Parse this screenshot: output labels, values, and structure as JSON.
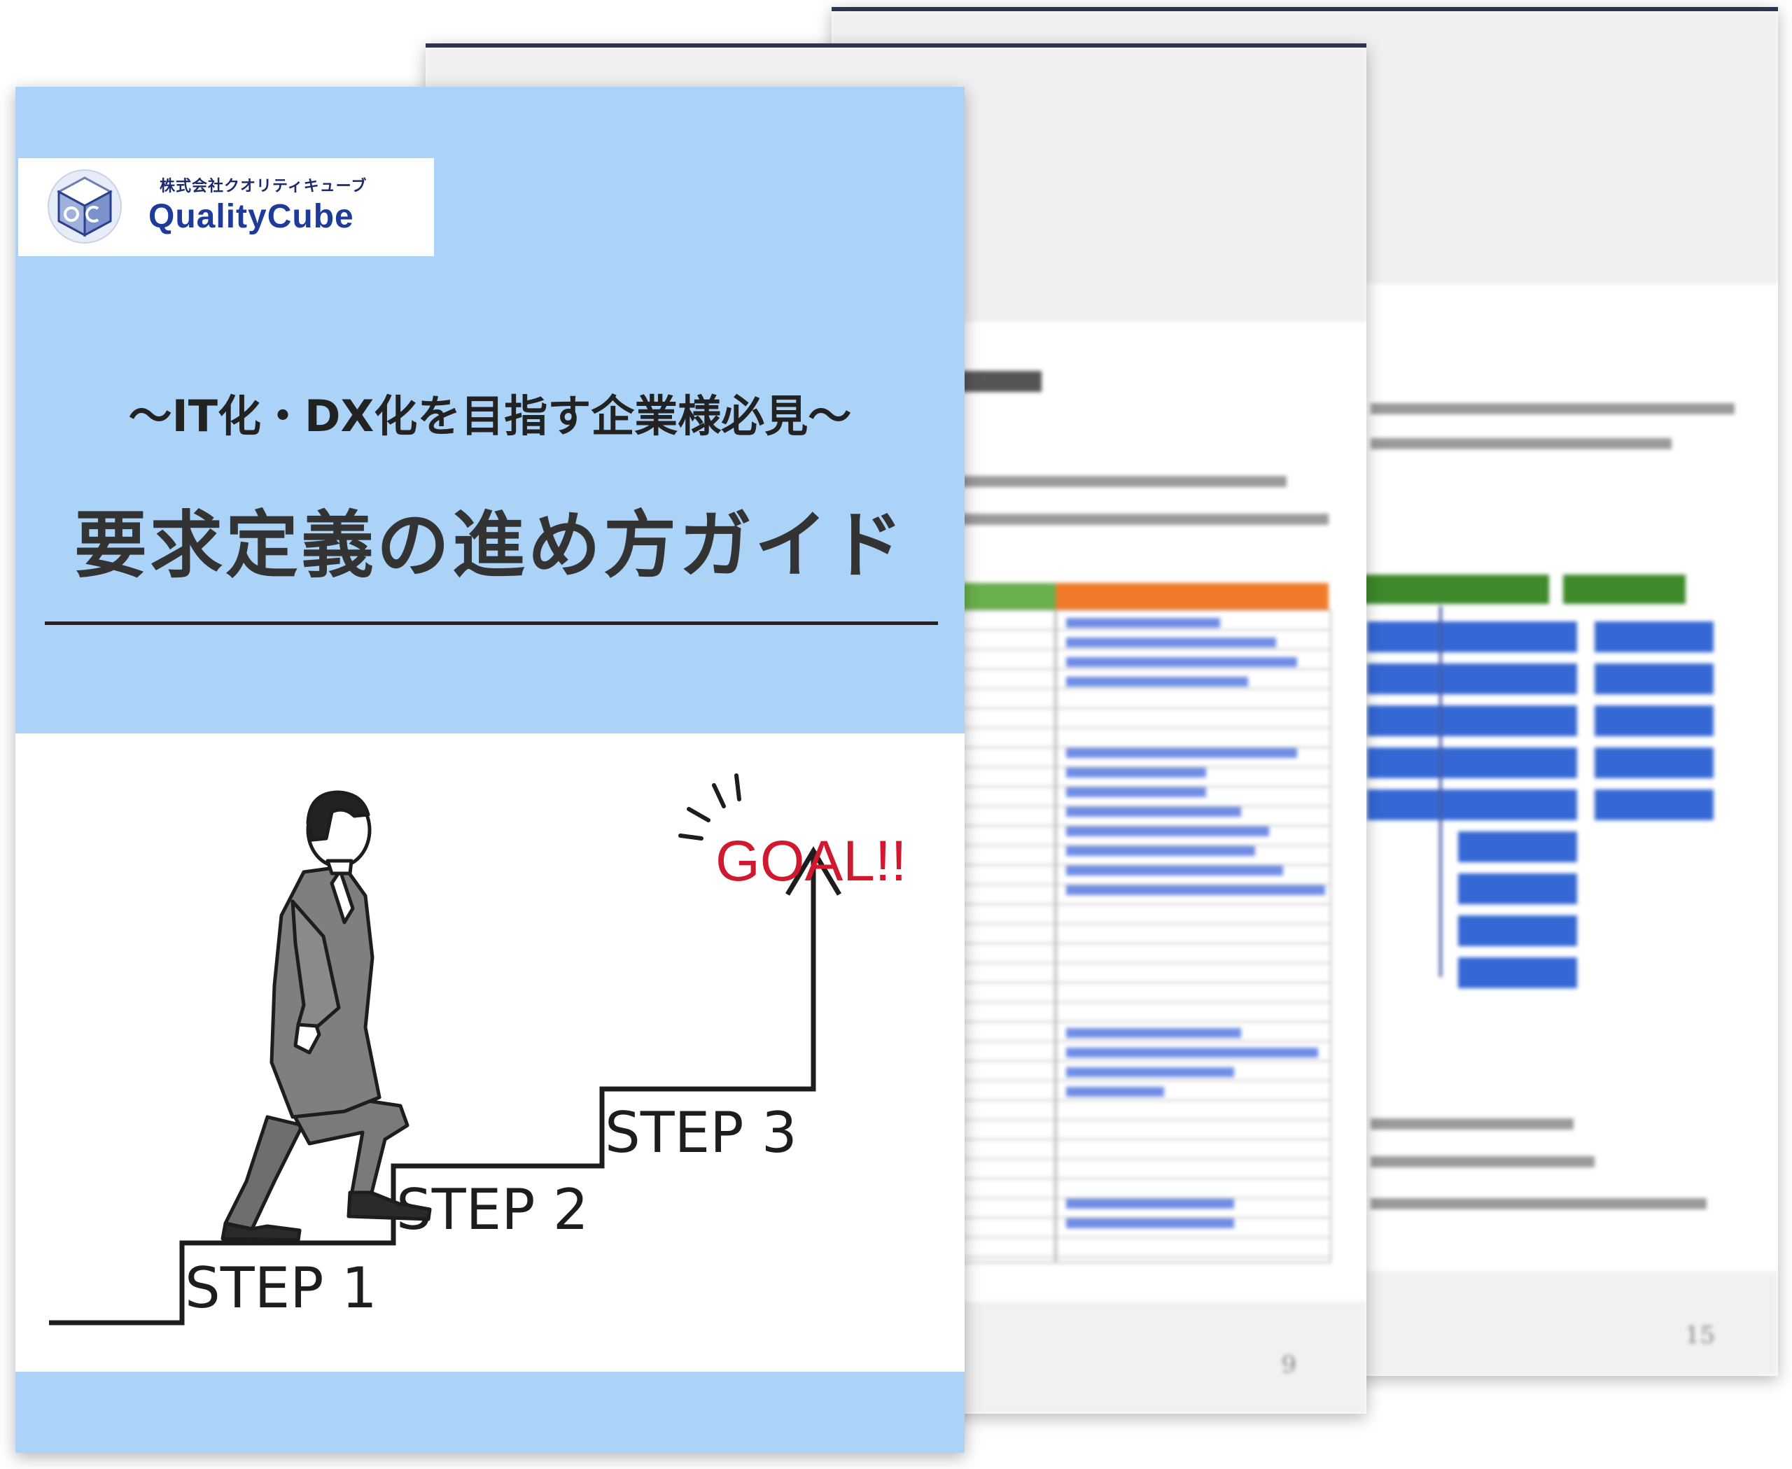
{
  "company": {
    "name_ja": "株式会社クオリティキューブ",
    "brand": "QualityCube"
  },
  "cover": {
    "subtitle": "〜IT化・DX化を目指す企業様必見〜",
    "title": "要求定義の進め方ガイド"
  },
  "illustration": {
    "steps": [
      "STEP 1",
      "STEP 2",
      "STEP 3"
    ],
    "goal": "GOAL!!"
  },
  "preview_pages": {
    "middle": {
      "page_number": "9"
    },
    "back": {
      "page_number": "15"
    }
  },
  "colors": {
    "cover_blue": "#abd3f8",
    "brand_navy": "#1f3b99",
    "goal_red": "#d0192f",
    "table_green": "#6ab04c",
    "table_orange": "#ef7b2a",
    "diagram_blue": "#3568d4"
  }
}
